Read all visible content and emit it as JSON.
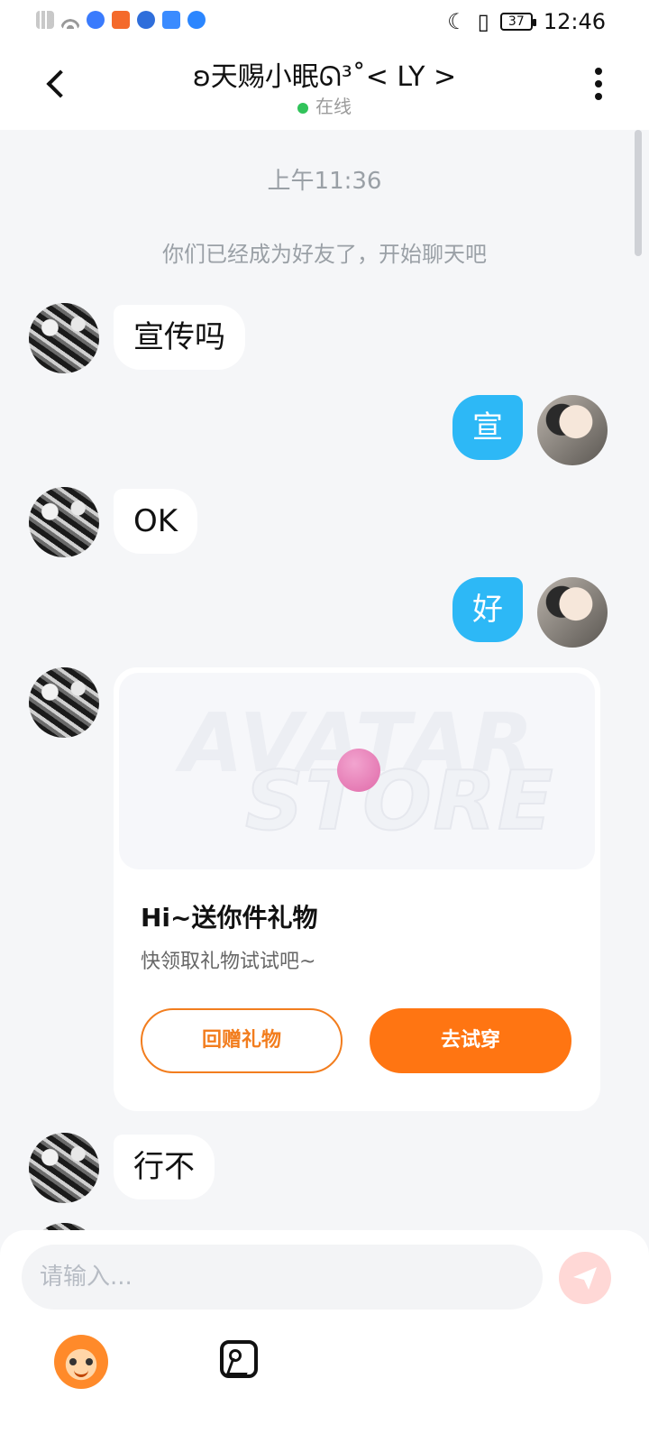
{
  "status_bar": {
    "time": "12:46",
    "battery": "37",
    "icons": [
      "signal-off-icon",
      "wifi-icon",
      "app-icon",
      "app-icon",
      "app-icon",
      "app-icon",
      "app-icon",
      "do-not-disturb-icon",
      "vibrate-icon",
      "battery-icon"
    ]
  },
  "header": {
    "title": "ʚ天赐小眠ᘏ³˚< LY >",
    "status": "在线",
    "back_icon": "chevron-left-icon",
    "more_icon": "more-vertical-icon"
  },
  "chat": {
    "time": "上午11:36",
    "system_notice": "你们已经成为好友了，开始聊天吧",
    "messages": [
      {
        "side": "left",
        "text": "宣传吗"
      },
      {
        "side": "right",
        "text": "宣"
      },
      {
        "side": "left",
        "text": "OK"
      },
      {
        "side": "right",
        "text": "好"
      },
      {
        "side": "left",
        "text": "行不"
      }
    ],
    "gift_card": {
      "image_words": [
        "AVATAR",
        "STORE"
      ],
      "title": "Hi~送你件礼物",
      "subtitle": "快领取礼物试试吧~",
      "return_gift": "回赠礼物",
      "try_on": "去试穿"
    }
  },
  "composer": {
    "placeholder": "请输入...",
    "send_icon": "send-icon",
    "emoji_icon": "monkey-face-icon",
    "image_icon": "image-icon"
  },
  "colors": {
    "accent_blue": "#2db8f6",
    "accent_orange": "#ff7512",
    "online_green": "#31c35a"
  }
}
